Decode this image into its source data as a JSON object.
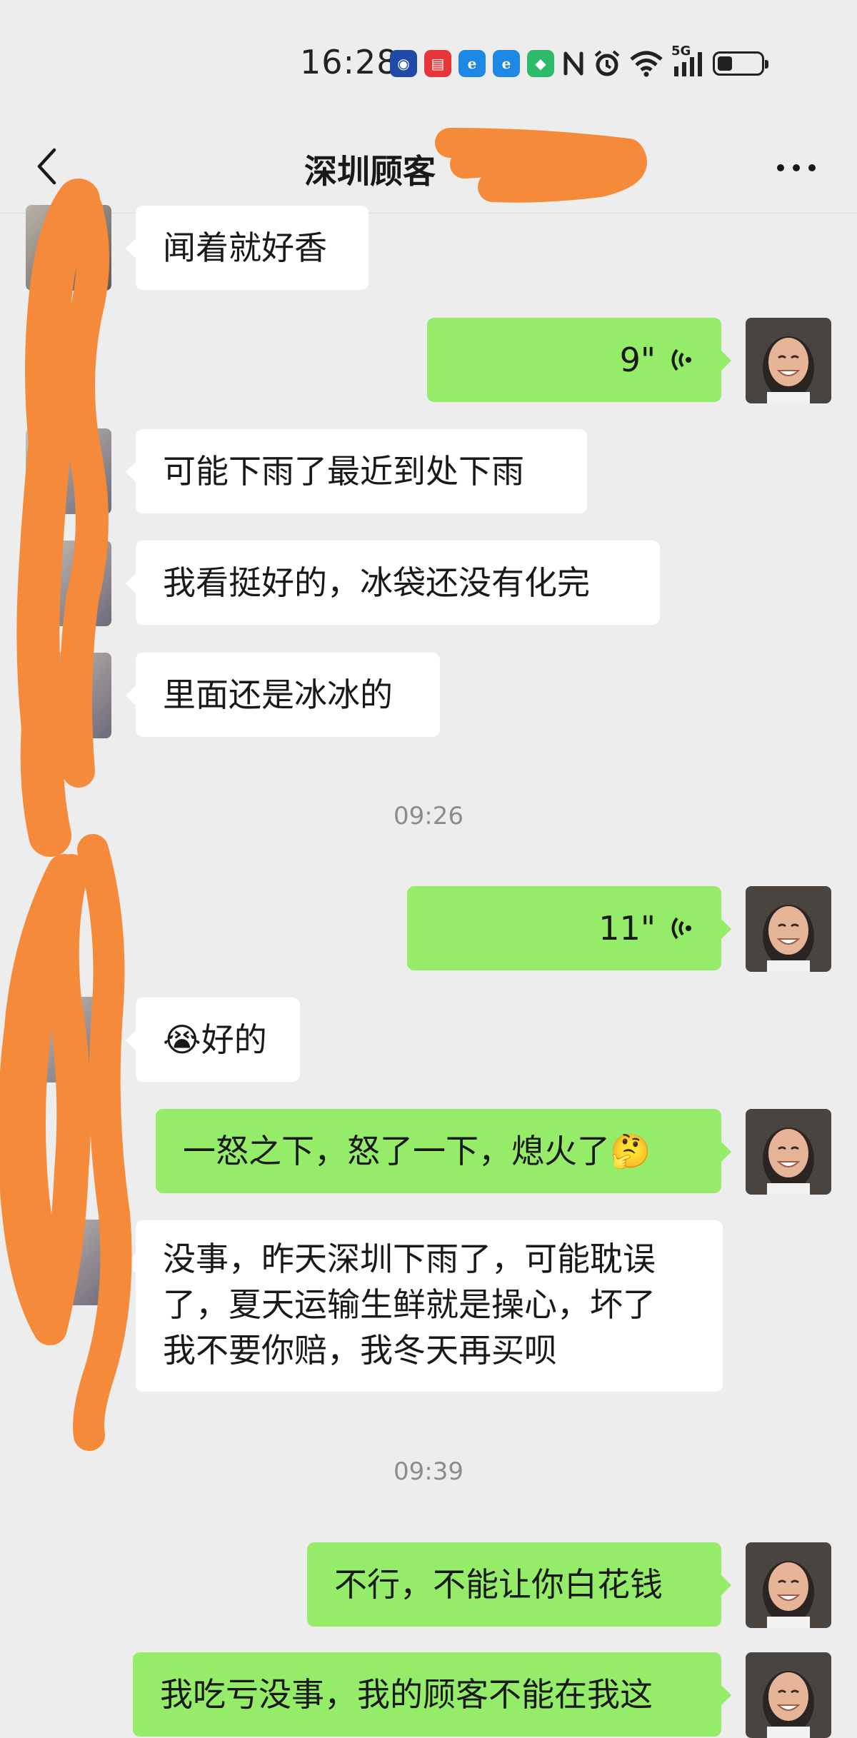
{
  "status_bar": {
    "time": "16:28",
    "app_icons": [
      {
        "name": "news-app-icon",
        "color": "#1f4aa8",
        "glyph": "◉"
      },
      {
        "name": "huawei-app-icon",
        "color": "#e8353a",
        "glyph": "▤"
      },
      {
        "name": "browser-e-icon",
        "color": "#1e88e5",
        "glyph": "e"
      },
      {
        "name": "browser-e-icon-2",
        "color": "#1e88e5",
        "glyph": "e"
      },
      {
        "name": "shield-app-icon",
        "color": "#2dbb6a",
        "glyph": "◆"
      }
    ],
    "network_label": "5G",
    "battery_level": 0.35
  },
  "header": {
    "title": "深圳顾客",
    "back_icon": "chevron-left-icon",
    "more_icon": "more-dots-icon"
  },
  "messages": [
    {
      "side": "in",
      "type": "text",
      "text": "闻着就好香"
    },
    {
      "side": "out",
      "type": "voice",
      "duration": "9\""
    },
    {
      "side": "in",
      "type": "text",
      "text": "可能下雨了最近到处下雨"
    },
    {
      "side": "in",
      "type": "text",
      "text": "我看挺好的，冰袋还没有化完"
    },
    {
      "side": "in",
      "type": "text",
      "text": "里面还是冰冰的"
    },
    {
      "type": "time",
      "text": "09:26"
    },
    {
      "side": "out",
      "type": "voice",
      "duration": "11\""
    },
    {
      "side": "in",
      "type": "text",
      "emoji": "😭",
      "text": "好的"
    },
    {
      "side": "out",
      "type": "text",
      "text": "一怒之下，怒了一下，熄火了",
      "emoji_after": "🤔"
    },
    {
      "side": "in",
      "type": "text",
      "lines": [
        "没事，昨天深圳下雨了，可能耽误",
        "了，夏天运输生鲜就是操心，坏了",
        "我不要你赔，我冬天再买呗"
      ]
    },
    {
      "type": "time",
      "text": "09:39"
    },
    {
      "side": "out",
      "type": "text",
      "text": "不行，不能让你白花钱"
    },
    {
      "side": "out",
      "type": "text",
      "text": "我吃亏没事，我的顾客不能在我这"
    }
  ],
  "colors": {
    "background": "#ededed",
    "incoming_bubble": "#ffffff",
    "outgoing_bubble": "#95ec69",
    "redaction": "#f58a3a"
  }
}
